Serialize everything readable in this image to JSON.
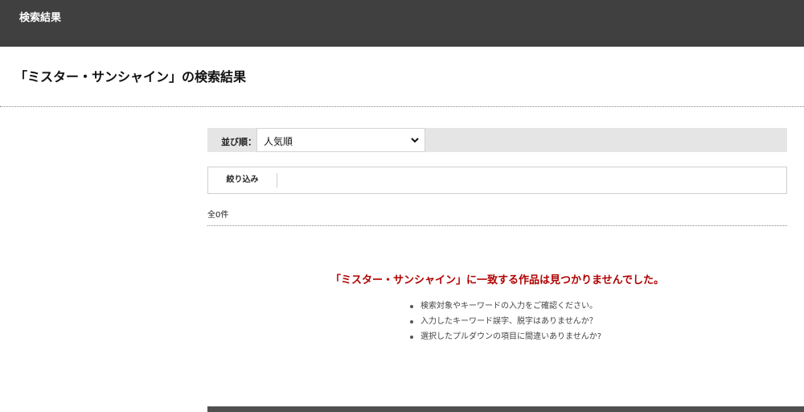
{
  "header": {
    "title": "検索結果"
  },
  "page": {
    "title": "「ミスター・サンシャイン」の検索結果"
  },
  "sort": {
    "label": "並び順：",
    "selected": "人気順"
  },
  "filter": {
    "tab_label": "絞り込み"
  },
  "results": {
    "count_text": "全0件",
    "no_result_message": "「ミスター・サンシャイン」に一致する作品は見つかりませんでした。",
    "tips": [
      "検索対象やキーワードの入力をご確認ください。",
      "入力したキーワード誤字、脱字はありませんか？",
      "選択したプルダウンの項目に間違いありませんか?"
    ]
  },
  "colors": {
    "header_bg": "#404040",
    "sort_bar_bg": "#e5e5e5",
    "error_text": "#b00000"
  }
}
